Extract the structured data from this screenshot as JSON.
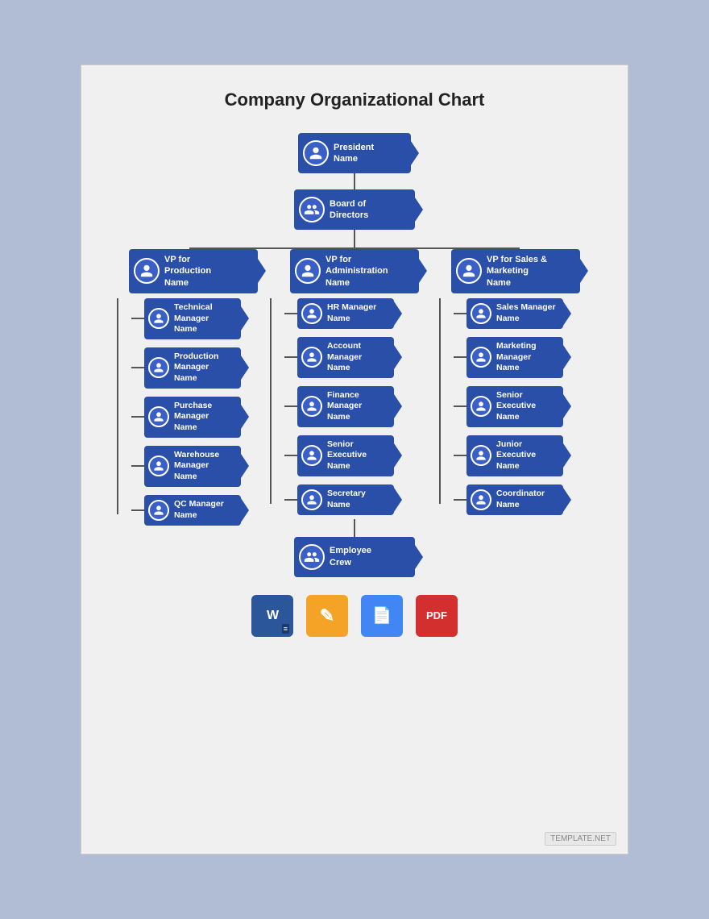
{
  "title": "Company Organizational Chart",
  "nodes": {
    "president": {
      "line1": "President",
      "line2": "Name"
    },
    "board": {
      "line1": "Board of",
      "line2": "Directors"
    },
    "vp_production": {
      "line1": "VP for",
      "line2": "Production",
      "line3": "Name"
    },
    "vp_admin": {
      "line1": "VP for",
      "line2": "Administration",
      "line3": "Name"
    },
    "vp_sales": {
      "line1": "VP for Sales &",
      "line2": "Marketing",
      "line3": "Name"
    },
    "col1": [
      {
        "line1": "Technical",
        "line2": "Manager",
        "line3": "Name"
      },
      {
        "line1": "Production",
        "line2": "Manager",
        "line3": "Name"
      },
      {
        "line1": "Purchase",
        "line2": "Manager",
        "line3": "Name"
      },
      {
        "line1": "Warehouse",
        "line2": "Manager",
        "line3": "Name"
      },
      {
        "line1": "QC Manager",
        "line2": "Name"
      }
    ],
    "col2": [
      {
        "line1": "HR Manager",
        "line2": "Name"
      },
      {
        "line1": "Account",
        "line2": "Manager",
        "line3": "Name"
      },
      {
        "line1": "Finance",
        "line2": "Manager",
        "line3": "Name"
      },
      {
        "line1": "Senior",
        "line2": "Executive",
        "line3": "Name"
      },
      {
        "line1": "Secretary",
        "line2": "Name"
      }
    ],
    "col3": [
      {
        "line1": "Sales Manager",
        "line2": "Name"
      },
      {
        "line1": "Marketing",
        "line2": "Manager",
        "line3": "Name"
      },
      {
        "line1": "Senior",
        "line2": "Executive",
        "line3": "Name"
      },
      {
        "line1": "Junior",
        "line2": "Executive",
        "line3": "Name"
      },
      {
        "line1": "Coordinator",
        "line2": "Name"
      }
    ],
    "employee": {
      "line1": "Employee",
      "line2": "Crew"
    }
  },
  "footer": {
    "word_label": "W",
    "pages_label": "✎",
    "docs_label": "≡",
    "pdf_label": "PDF",
    "watermark": "TEMPLATE.NET"
  }
}
